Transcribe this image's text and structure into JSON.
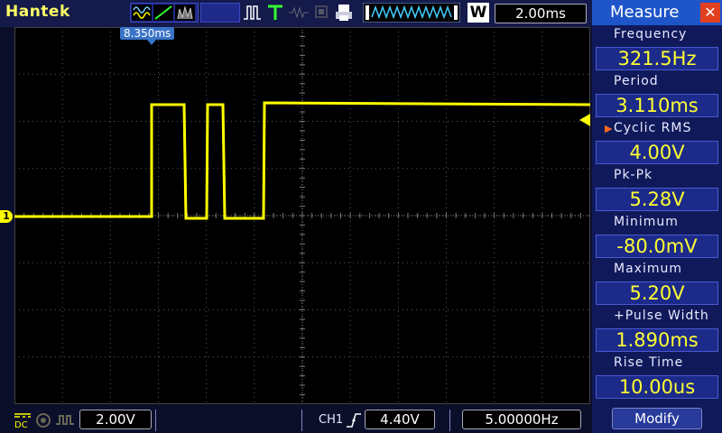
{
  "topbar": {
    "brand": "Hantek",
    "acquire_mode_icons": [
      "sine-wave-icon",
      "slope-icon",
      "peak-detect-icon"
    ],
    "run_mode_icon": "pulse-icon",
    "trigger_icon": "trigger-t-icon",
    "status_icons": [
      "waveform-record-icon",
      "printer-icon"
    ],
    "waveform_icon": "timebase-waveform-icon",
    "timebase_mode_label": "W",
    "timebase": "2.00ms"
  },
  "screen": {
    "trigger_time_marker": "8.350ms",
    "channel_marker": "1"
  },
  "measure": {
    "title": "Measure",
    "items": [
      {
        "label": "Frequency",
        "value": "321.5Hz"
      },
      {
        "label": "Period",
        "value": "3.110ms"
      },
      {
        "label": "Cyclic RMS",
        "value": "4.00V",
        "selected": true
      },
      {
        "label": "Pk-Pk",
        "value": "5.28V"
      },
      {
        "label": "Minimum",
        "value": "-80.0mV"
      },
      {
        "label": "Maximum",
        "value": "5.20V"
      },
      {
        "label": "+Pulse Width",
        "value": "1.890ms"
      },
      {
        "label": "Rise Time",
        "value": "10.00us"
      }
    ],
    "modify_label": "Modify"
  },
  "bottombar": {
    "coupling_label": "DC",
    "volts_div": "2.00V",
    "trigger_channel": "CH1",
    "trigger_level": "4.40V",
    "trigger_frequency": "5.00000Hz"
  },
  "colors": {
    "trace": "#ffff00",
    "grid": "#5a5a5a",
    "panel_bg": "#101a5a",
    "header_bg": "#1e55c8",
    "close_bg": "#e04020",
    "value_text": "#ffff33"
  }
}
